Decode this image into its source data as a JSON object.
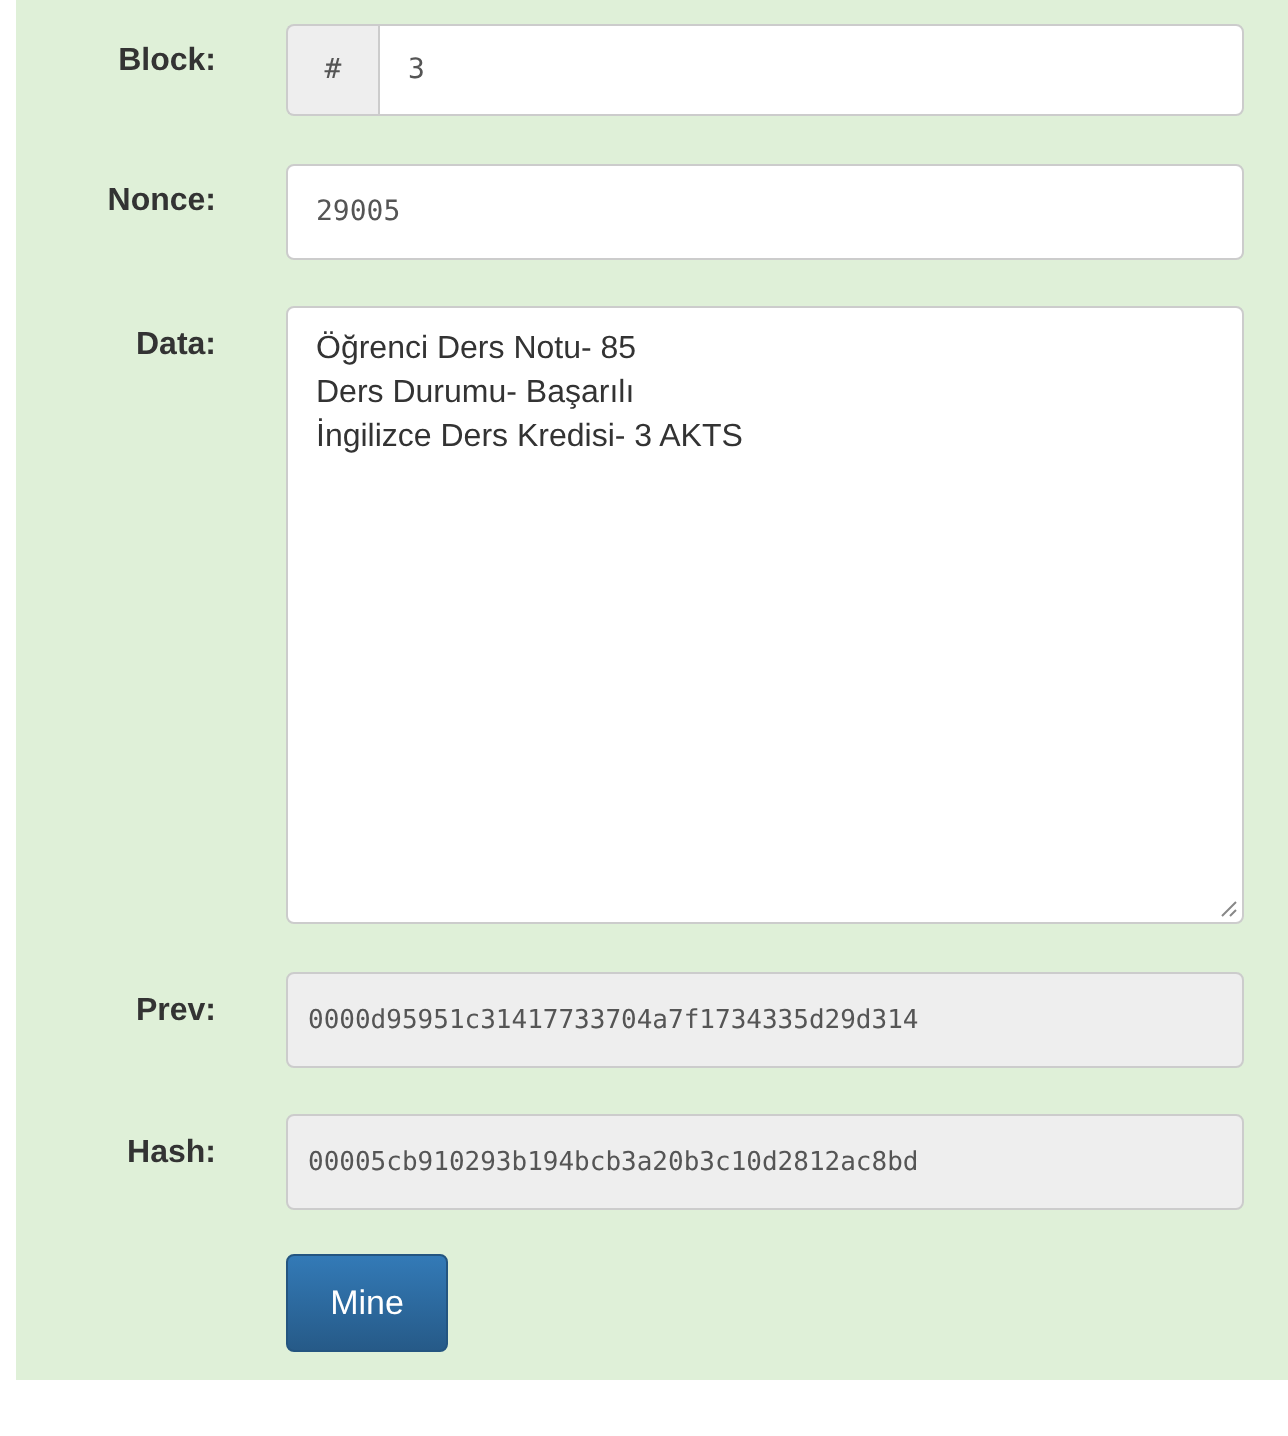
{
  "block": {
    "label": "Block:",
    "addon": "#",
    "value": "3"
  },
  "nonce": {
    "label": "Nonce:",
    "value": "29005"
  },
  "data": {
    "label": "Data:",
    "lines": [
      "Öğrenci Ders Notu- 85",
      "Ders Durumu- Başarılı",
      "İngilizce Ders Kredisi- 3 AKTS"
    ]
  },
  "prev": {
    "label": "Prev:",
    "value": "0000d95951c31417733704a7f1734335d29d314",
    "disabled": true
  },
  "hash": {
    "label": "Hash:",
    "value": "00005cb910293b194bcb3a20b3c10d2812ac8bd",
    "disabled": true
  },
  "button": "Mine"
}
